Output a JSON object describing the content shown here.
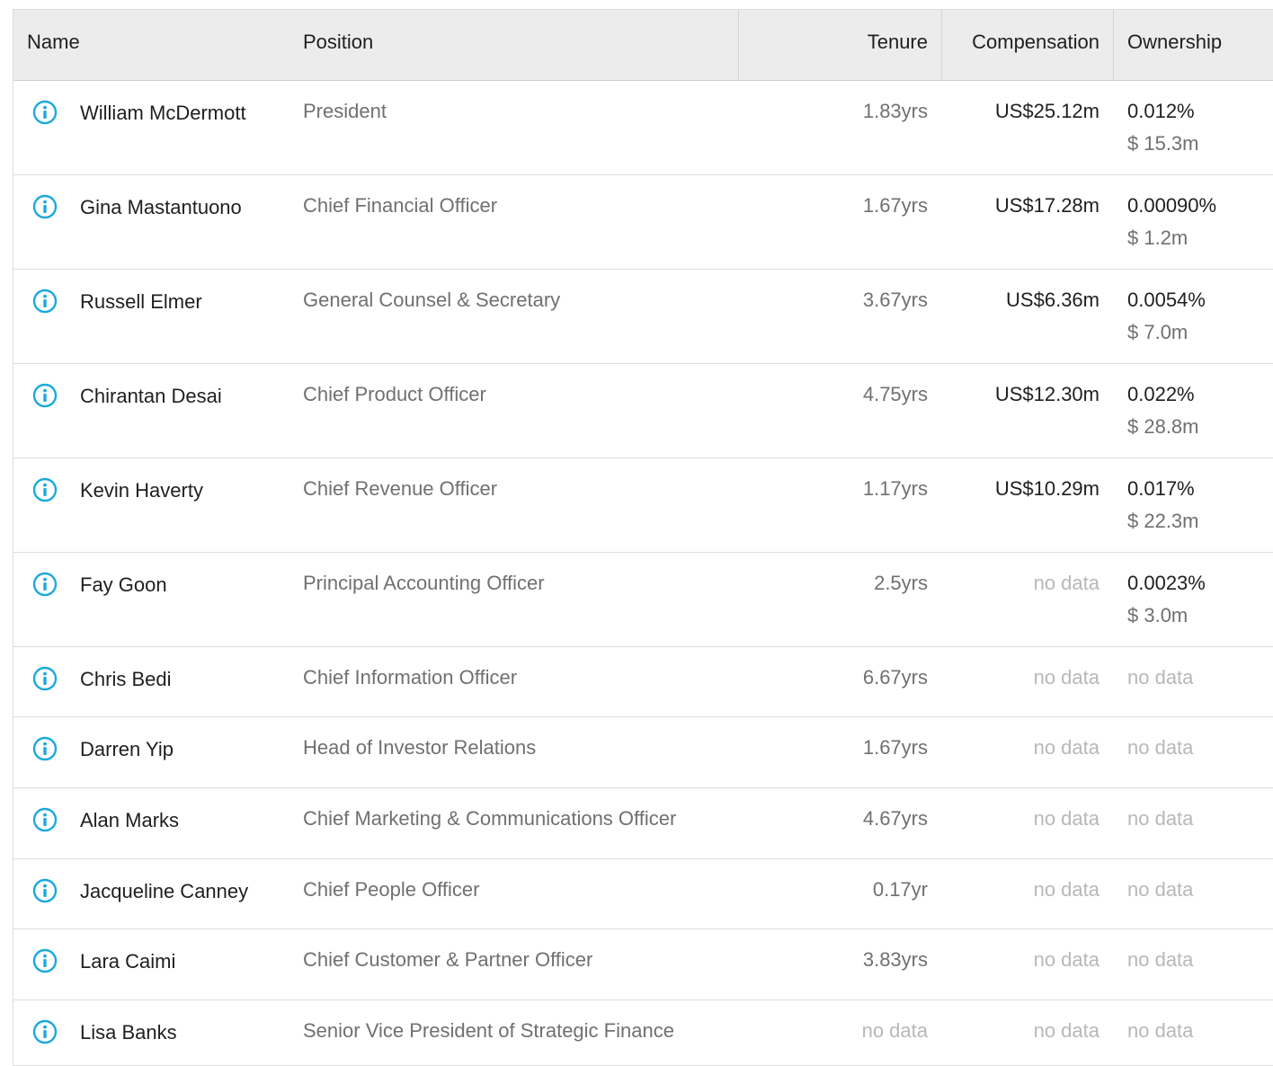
{
  "table": {
    "headers": {
      "name": "Name",
      "position": "Position",
      "tenure": "Tenure",
      "compensation": "Compensation",
      "ownership": "Ownership"
    },
    "rows": [
      {
        "name": "William McDermott",
        "position": "President",
        "tenure": "1.83yrs",
        "compensation": "US$25.12m",
        "ownership_pct": "0.012%",
        "ownership_value": "$ 15.3m"
      },
      {
        "name": "Gina Mastantuono",
        "position": "Chief Financial Officer",
        "tenure": "1.67yrs",
        "compensation": "US$17.28m",
        "ownership_pct": "0.00090%",
        "ownership_value": "$ 1.2m"
      },
      {
        "name": "Russell Elmer",
        "position": "General Counsel & Secretary",
        "tenure": "3.67yrs",
        "compensation": "US$6.36m",
        "ownership_pct": "0.0054%",
        "ownership_value": "$ 7.0m"
      },
      {
        "name": "Chirantan Desai",
        "position": "Chief Product Officer",
        "tenure": "4.75yrs",
        "compensation": "US$12.30m",
        "ownership_pct": "0.022%",
        "ownership_value": "$ 28.8m"
      },
      {
        "name": "Kevin Haverty",
        "position": "Chief Revenue Officer",
        "tenure": "1.17yrs",
        "compensation": "US$10.29m",
        "ownership_pct": "0.017%",
        "ownership_value": "$ 22.3m"
      },
      {
        "name": "Fay Goon",
        "position": "Principal Accounting Officer",
        "tenure": "2.5yrs",
        "compensation": "no data",
        "ownership_pct": "0.0023%",
        "ownership_value": "$ 3.0m"
      },
      {
        "name": "Chris Bedi",
        "position": "Chief Information Officer",
        "tenure": "6.67yrs",
        "compensation": "no data",
        "ownership_pct": "no data",
        "ownership_value": ""
      },
      {
        "name": "Darren Yip",
        "position": "Head of Investor Relations",
        "tenure": "1.67yrs",
        "compensation": "no data",
        "ownership_pct": "no data",
        "ownership_value": ""
      },
      {
        "name": "Alan Marks",
        "position": "Chief Marketing & Communications Officer",
        "tenure": "4.67yrs",
        "compensation": "no data",
        "ownership_pct": "no data",
        "ownership_value": ""
      },
      {
        "name": "Jacqueline Canney",
        "position": "Chief People Officer",
        "tenure": "0.17yr",
        "compensation": "no data",
        "ownership_pct": "no data",
        "ownership_value": ""
      },
      {
        "name": "Lara Caimi",
        "position": "Chief Customer & Partner Officer",
        "tenure": "3.83yrs",
        "compensation": "no data",
        "ownership_pct": "no data",
        "ownership_value": ""
      },
      {
        "name": "Lisa Banks",
        "position": "Senior Vice President of Strategic Finance",
        "tenure": "no data",
        "compensation": "no data",
        "ownership_pct": "no data",
        "ownership_value": ""
      }
    ]
  },
  "icons": {
    "row_info": "info-circle-icon"
  },
  "colors": {
    "info_icon": "#1aa9de",
    "header_bg": "#ececec",
    "muted_text": "#707070",
    "no_data_text": "#b8b8b8"
  }
}
